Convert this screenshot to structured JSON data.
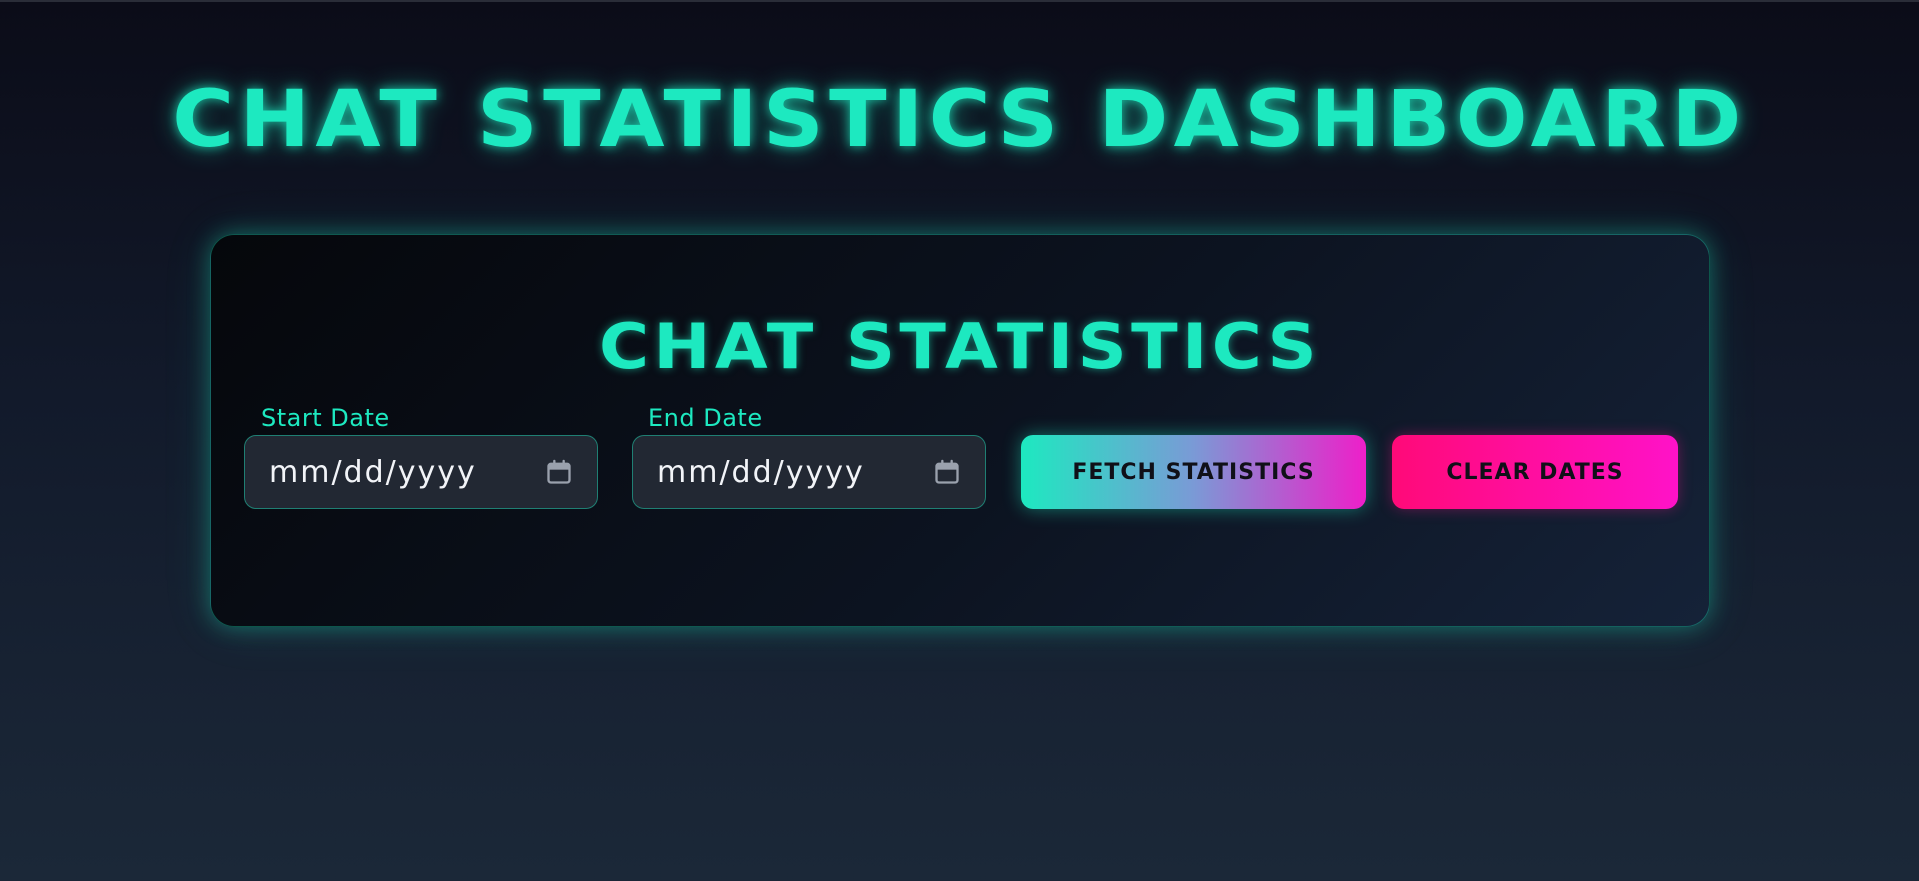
{
  "page": {
    "title": "CHAT STATISTICS DASHBOARD"
  },
  "card": {
    "title": "CHAT STATISTICS",
    "start_date": {
      "label": "Start Date",
      "value": "mm/dd/yyyy"
    },
    "end_date": {
      "label": "End Date",
      "value": "mm/dd/yyyy"
    },
    "fetch_button": "FETCH STATISTICS",
    "clear_button": "CLEAR DATES"
  },
  "icons": {
    "date_picker": "calendar-icon"
  },
  "colors": {
    "accent": "#1de9c0",
    "magenta": "#ee1fc9",
    "pink": "#ff0a78",
    "input_bg": "#222833"
  }
}
